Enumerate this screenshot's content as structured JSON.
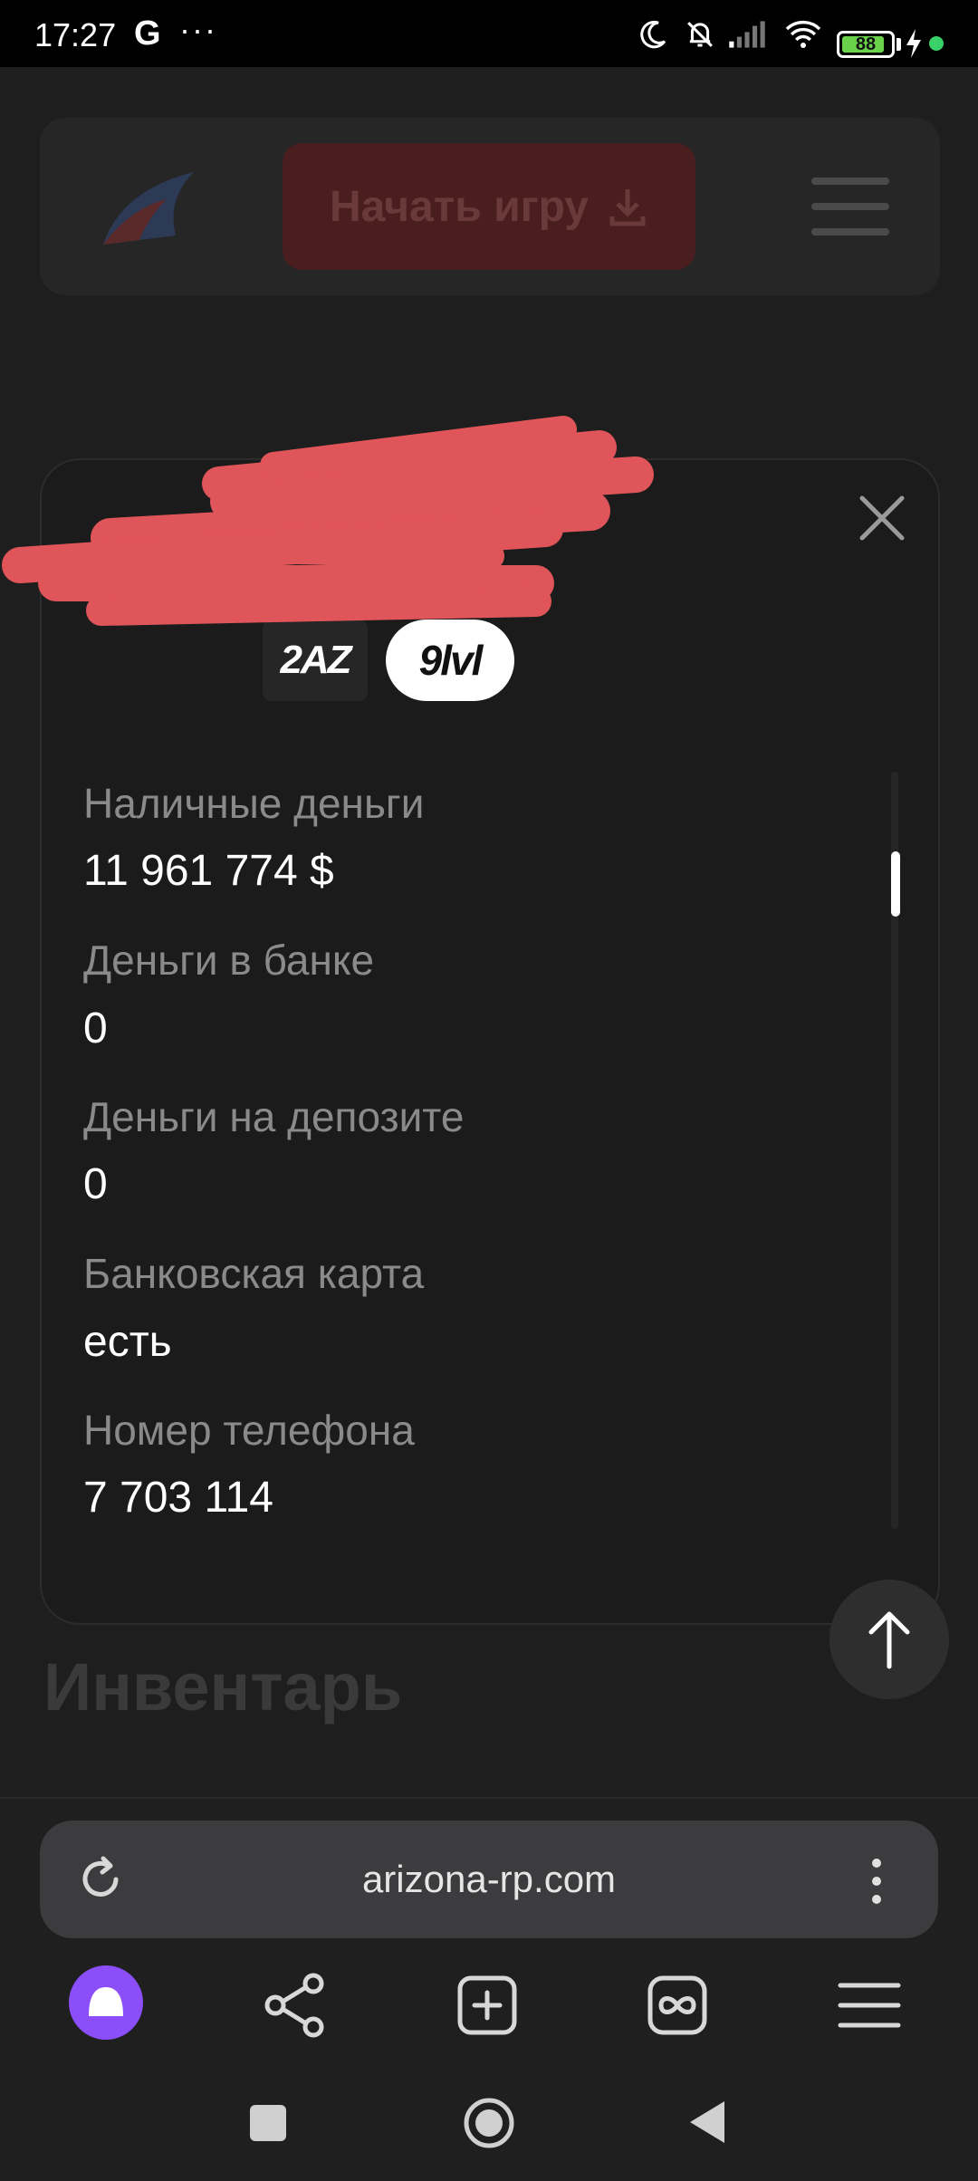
{
  "status_bar": {
    "time": "17:27",
    "g_icon": "G",
    "overflow": "···",
    "battery_level": "88",
    "battery_fraction": 0.88
  },
  "site": {
    "start_game_label": "Начать игру",
    "inventory_heading": "Инвентарь"
  },
  "profile": {
    "server_badge": "2AZ",
    "level_badge": "9lvl",
    "fields": [
      {
        "label": "Наличные деньги",
        "value": "11 961 774 $"
      },
      {
        "label": "Деньги в банке",
        "value": "0"
      },
      {
        "label": "Деньги на депозите",
        "value": "0"
      },
      {
        "label": "Банковская карта",
        "value": "есть"
      },
      {
        "label": "Номер телефона",
        "value": "7 703 114"
      }
    ]
  },
  "browser": {
    "url": "arizona-rp.com"
  },
  "icons": {
    "close": "close-icon",
    "scroll_top": "arrow-up-icon",
    "reload": "reload-icon",
    "more": "more-vertical-icon",
    "alice": "alice-assistant-icon",
    "share": "share-icon",
    "new_tab": "plus-square-icon",
    "tabs": "infinity-tabs-icon",
    "menu": "hamburger-menu-icon"
  },
  "colors": {
    "accent_purple": "#8c4ef8",
    "redaction": "#e0555a",
    "start_button": "#4a1e1f"
  }
}
